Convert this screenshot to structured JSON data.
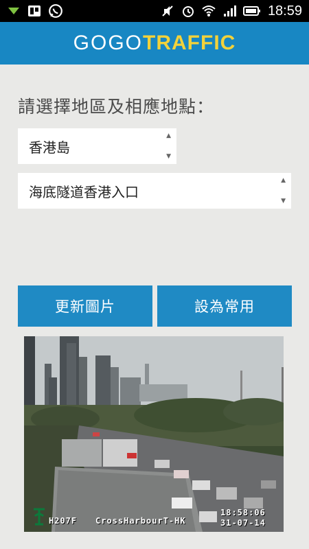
{
  "status_bar": {
    "time": "18:59",
    "left_icons": [
      "download-arrow-icon",
      "trello-icon",
      "whatsapp-icon"
    ],
    "right_icons": [
      "mute-icon",
      "alarm-icon",
      "wifi-icon",
      "signal-icon",
      "battery-icon"
    ]
  },
  "header": {
    "logo_part1": "GOGO",
    "logo_part2": "TRAFFIC",
    "colors": {
      "bar": "#1887c3",
      "accent": "#f2d23b"
    }
  },
  "form": {
    "prompt": "請選擇地區及相應地點：",
    "region_value": "香港島",
    "location_value": "海底隧道香港入口"
  },
  "buttons": {
    "refresh": "更新圖片",
    "set_favorite": "設為常用"
  },
  "camera": {
    "camera_code": "H207F",
    "camera_label": "CrossHarbourT-HK",
    "time": "18:58:06",
    "date": "31-07-14"
  }
}
